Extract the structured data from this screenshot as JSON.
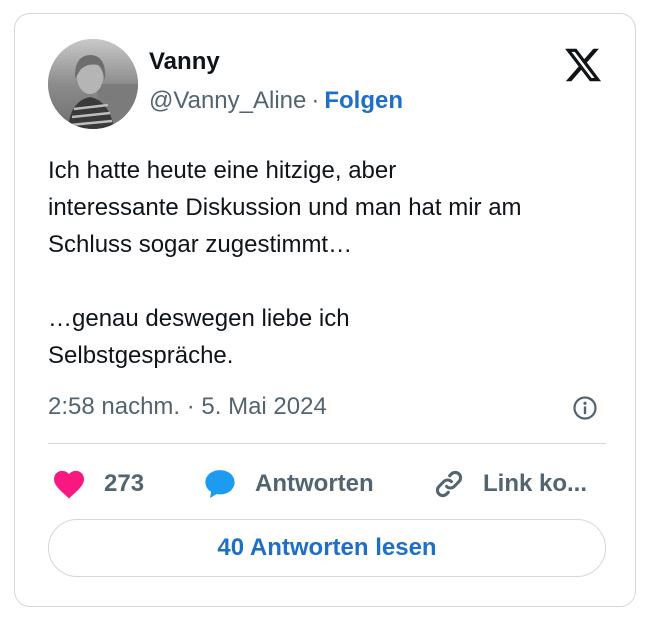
{
  "author": {
    "name": "Vanny",
    "handle": "@Vanny_Aline",
    "separator": "·",
    "follow_label": "Folgen"
  },
  "tweet": {
    "text": "Ich hatte heute eine hitzige, aber\ninteressante Diskussion und man hat mir am\nSchluss sogar zugestimmt…\n\n…genau deswegen liebe ich\nSelbstgespräche.",
    "timestamp": "2:58 nachm. · 5. Mai 2024"
  },
  "actions": {
    "like_count": "273",
    "reply_label": "Antworten",
    "copy_link_label": "Link ko..."
  },
  "read_replies_label": "40 Antworten lesen",
  "icons": {
    "brand": "x-logo-icon",
    "like": "heart-icon",
    "reply": "speech-bubble-icon",
    "copy_link": "link-icon",
    "info": "info-icon"
  },
  "colors": {
    "heart": "#f91880",
    "reply_bubble": "#1d9bf0",
    "link_blue": "#1d6fc8",
    "secondary_text": "#536471",
    "border": "#cfd9de"
  }
}
